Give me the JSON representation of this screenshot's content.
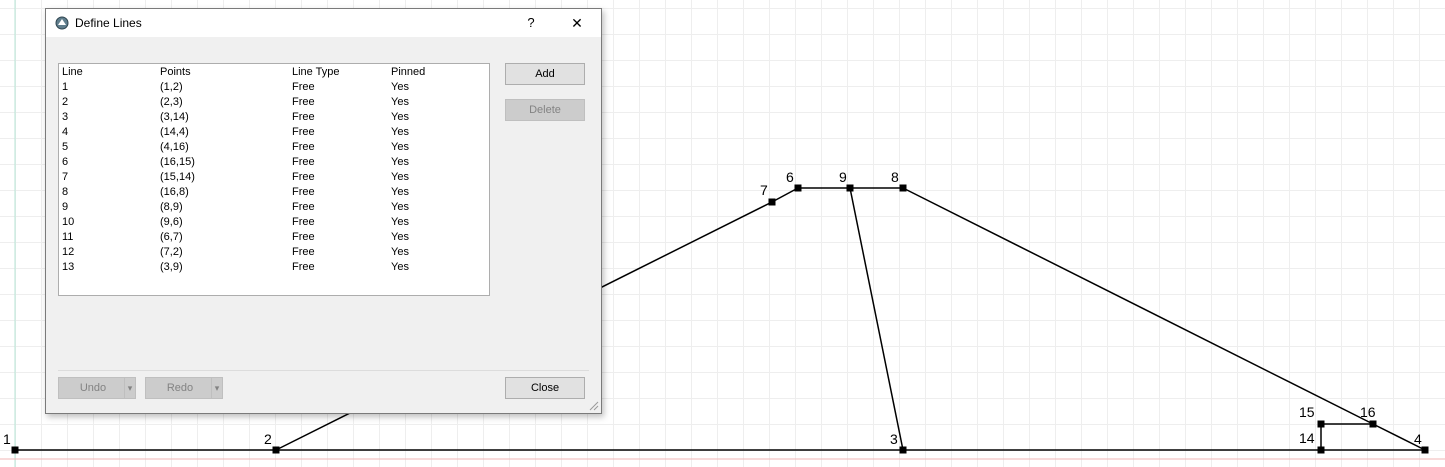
{
  "canvas": {
    "points": [
      {
        "id": "1",
        "label": "1"
      },
      {
        "id": "2",
        "label": "2"
      },
      {
        "id": "3",
        "label": "3"
      },
      {
        "id": "4",
        "label": "4"
      },
      {
        "id": "6",
        "label": "6"
      },
      {
        "id": "7",
        "label": "7"
      },
      {
        "id": "8",
        "label": "8"
      },
      {
        "id": "9",
        "label": "9"
      },
      {
        "id": "14",
        "label": "14"
      },
      {
        "id": "15",
        "label": "15"
      },
      {
        "id": "16",
        "label": "16"
      }
    ]
  },
  "dialog": {
    "title": "Define Lines",
    "help_label": "?",
    "close_symbol": "✕",
    "table": {
      "headers": [
        "Line",
        "Points",
        "Line Type",
        "Pinned"
      ],
      "rows": [
        [
          "1",
          "(1,2)",
          "Free",
          "Yes"
        ],
        [
          "2",
          "(2,3)",
          "Free",
          "Yes"
        ],
        [
          "3",
          "(3,14)",
          "Free",
          "Yes"
        ],
        [
          "4",
          "(14,4)",
          "Free",
          "Yes"
        ],
        [
          "5",
          "(4,16)",
          "Free",
          "Yes"
        ],
        [
          "6",
          "(16,15)",
          "Free",
          "Yes"
        ],
        [
          "7",
          "(15,14)",
          "Free",
          "Yes"
        ],
        [
          "8",
          "(16,8)",
          "Free",
          "Yes"
        ],
        [
          "9",
          "(8,9)",
          "Free",
          "Yes"
        ],
        [
          "10",
          "(9,6)",
          "Free",
          "Yes"
        ],
        [
          "11",
          "(6,7)",
          "Free",
          "Yes"
        ],
        [
          "12",
          "(7,2)",
          "Free",
          "Yes"
        ],
        [
          "13",
          "(3,9)",
          "Free",
          "Yes"
        ]
      ]
    },
    "buttons": {
      "add": "Add",
      "delete": "Delete",
      "undo": "Undo",
      "redo": "Redo",
      "close": "Close",
      "dropdown_symbol": "▾"
    }
  }
}
